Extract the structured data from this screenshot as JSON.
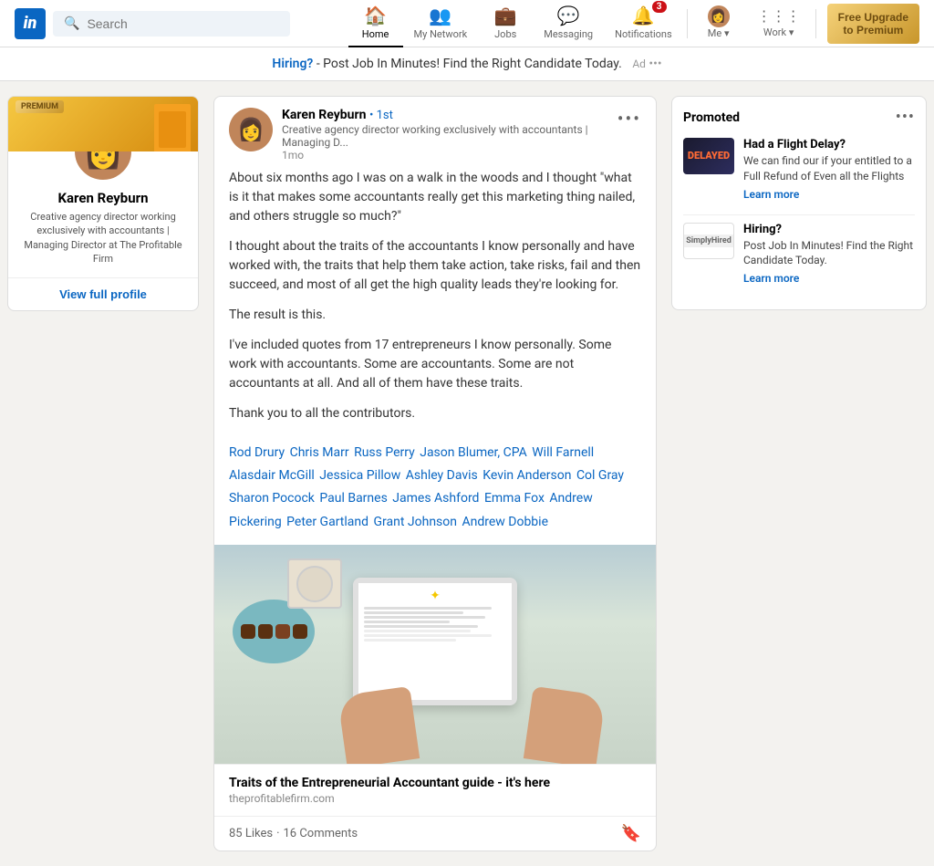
{
  "navbar": {
    "logo": "in",
    "search_placeholder": "Search",
    "nav_items": [
      {
        "id": "home",
        "label": "Home",
        "icon": "🏠",
        "active": true
      },
      {
        "id": "network",
        "label": "My Network",
        "icon": "👥",
        "active": false
      },
      {
        "id": "jobs",
        "label": "Jobs",
        "icon": "💼",
        "active": false
      },
      {
        "id": "messaging",
        "label": "Messaging",
        "icon": "💬",
        "active": false
      },
      {
        "id": "notifications",
        "label": "Notifications",
        "icon": "🔔",
        "active": false,
        "badge": "3"
      },
      {
        "id": "me",
        "label": "Me",
        "icon": "👤",
        "active": false,
        "has_dropdown": true
      },
      {
        "id": "work",
        "label": "Work",
        "icon": "⋮⋮⋮",
        "active": false,
        "has_dropdown": true
      }
    ],
    "premium_label": "Free Upgrade\nto Premium"
  },
  "top_banner": {
    "text_normal": " - Post Job In Minutes! Find the Right Candidate Today.",
    "text_highlight": "Hiring?",
    "ad_tag": "Ad"
  },
  "left_sidebar": {
    "premium_badge": "PREMIUM",
    "user": {
      "name": "Karen Reyburn",
      "description": "Creative agency director working exclusively with accountants | Managing Director at The Profitable Firm",
      "avatar_emoji": "👩"
    },
    "view_profile_label": "View full profile"
  },
  "post": {
    "author": {
      "name": "Karen Reyburn",
      "degree": "• 1st",
      "title": "Creative agency director working exclusively with accountants | Managing D...",
      "time": "1mo",
      "avatar_emoji": "👩"
    },
    "more_options": "•••",
    "body": [
      "About six months ago I was on a walk in the woods and I thought \"what is it that makes some accountants really get this marketing thing nailed, and others struggle so much?\"",
      "I thought about the traits of the accountants I know personally and have worked with, the traits that help them take action, take risks, fail and then succeed, and most of all get the high quality leads they're looking for.",
      "The result is this.",
      "I've included quotes from 17 entrepreneurs I know personally. Some work with accountants. Some are accountants. Some are not accountants at all. And all of them have these traits.",
      "Thank you to all the contributors."
    ],
    "contributors": [
      "Rod Drury",
      "Chris Marr",
      "Russ Perry",
      "Jason Blumer, CPA",
      "Will Farnell",
      "Alasdair McGill",
      "Jessica Pillow",
      "Ashley Davis",
      "Kevin Anderson",
      "Col Gray",
      "Sharon Pocock",
      "Paul Barnes",
      "James Ashford",
      "Emma Fox",
      "Andrew Pickering",
      "Peter Gartland",
      "Grant Johnson",
      "Andrew Dobbie"
    ],
    "link_preview": {
      "title": "Traits of the Entrepreneurial Accountant guide - it's here",
      "url": "theprofitablefirm.com"
    },
    "stats": {
      "likes": "85 Likes",
      "dot": "·",
      "comments": "16 Comments"
    }
  },
  "right_sidebar": {
    "promo_title": "Promoted",
    "promo_menu": "•••",
    "items": [
      {
        "id": "flight",
        "thumb_type": "delay",
        "thumb_text": "DELAYED",
        "title": "Had a Flight Delay?",
        "description": "We can find our if your entitled to a Full Refund of Even all the Flights",
        "learn_more": "Learn more"
      },
      {
        "id": "hiring",
        "thumb_type": "hiring",
        "thumb_text": "SimplyHired",
        "title": "Hiring?",
        "description": "Post Job In Minutes! Find the Right Candidate Today.",
        "learn_more": "Learn more"
      }
    ]
  }
}
